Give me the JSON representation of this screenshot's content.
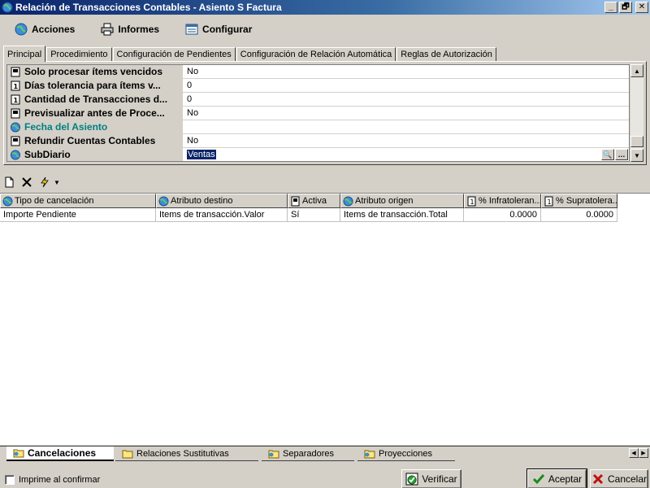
{
  "window": {
    "title": "Relación de Transacciones Contables - Asiento S Factura",
    "minimize": "_",
    "restore": "🗗",
    "close": "✕"
  },
  "menu": {
    "acciones": "Acciones",
    "informes": "Informes",
    "configurar": "Configurar"
  },
  "tabs": [
    "Principal",
    "Procedimiento",
    "Configuración de Pendientes",
    "Configuración de Relación Automática",
    "Reglas de Autorización"
  ],
  "properties": [
    {
      "name": "Solo procesar ítems vencidos",
      "value": "No"
    },
    {
      "name": "Días tolerancia para ítems v...",
      "value": "0"
    },
    {
      "name": "Cantidad de Transacciones d...",
      "value": "0"
    },
    {
      "name": "Previsualizar antes de Proce...",
      "value": "No"
    },
    {
      "name": "Fecha del Asiento",
      "value": ""
    },
    {
      "name": "Refundir Cuentas Contables",
      "value": "No"
    },
    {
      "name": "SubDiario",
      "value": "Ventas"
    }
  ],
  "grid": {
    "columns": [
      "Tipo de cancelación",
      "Atributo destino",
      "Activa",
      "Atributo origen",
      "% Infratoleran...",
      "% Supratolera..."
    ],
    "rows": [
      [
        "Importe Pendiente",
        "Items de transacción.Valor",
        "Sí",
        "Items de transacción.Total",
        "0.0000",
        "0.0000"
      ]
    ]
  },
  "bottom_tabs": [
    "Cancelaciones",
    "Relaciones Sustitutivas",
    "Separadores",
    "Proyecciones"
  ],
  "footer": {
    "imprime": "Imprime al confirmar",
    "verificar": "Verificar",
    "aceptar": "Aceptar",
    "cancelar": "Cancelar"
  },
  "colors": {
    "title_bar": "#0a246a",
    "teal_field": "#008080",
    "selection": "#0a246a"
  }
}
